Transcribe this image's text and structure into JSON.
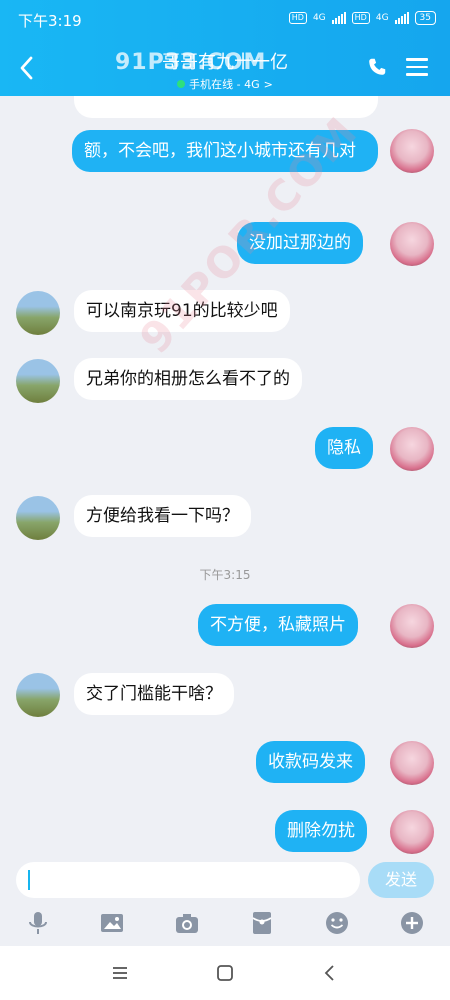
{
  "status": {
    "time": "下午3:19",
    "hd1": "HD",
    "net1": "4G",
    "hd2": "HD",
    "net2": "4G",
    "battery": "35"
  },
  "header": {
    "title": "哥哥有九十一亿",
    "subtitle": "手机在线 - 4G",
    "subtitle_arrow": ">",
    "watermark": "91P33.COM"
  },
  "watermark_diag": "91POR.COM",
  "messages": [
    {
      "side": "out",
      "text": "额，不会吧，我们这小城市还有几对"
    },
    {
      "side": "out",
      "text": "没加过那边的"
    },
    {
      "side": "in",
      "text": "可以南京玩91的比较少吧"
    },
    {
      "side": "in",
      "text": "兄弟你的相册怎么看不了的"
    },
    {
      "side": "out",
      "text": "隐私"
    },
    {
      "side": "in",
      "text": "方便给我看一下吗？"
    },
    {
      "side": "out",
      "text": "不方便，私藏照片"
    },
    {
      "side": "in",
      "text": "交了门槛能干啥？"
    },
    {
      "side": "out",
      "text": "收款码发来"
    },
    {
      "side": "out",
      "text": "删除勿扰"
    }
  ],
  "timestamp": "下午3:15",
  "composer": {
    "input_value": "",
    "send_label": "发送"
  },
  "toolbar": [
    "microphone-icon",
    "image-icon",
    "camera-icon",
    "red-packet-icon",
    "emoji-icon",
    "plus-icon"
  ],
  "colors": {
    "header": "#19b7f4",
    "outgoing_bubble": "#1fb2f4",
    "incoming_bubble": "#ffffff",
    "background": "#eef0f5",
    "send_button": "#a8dcf7"
  }
}
